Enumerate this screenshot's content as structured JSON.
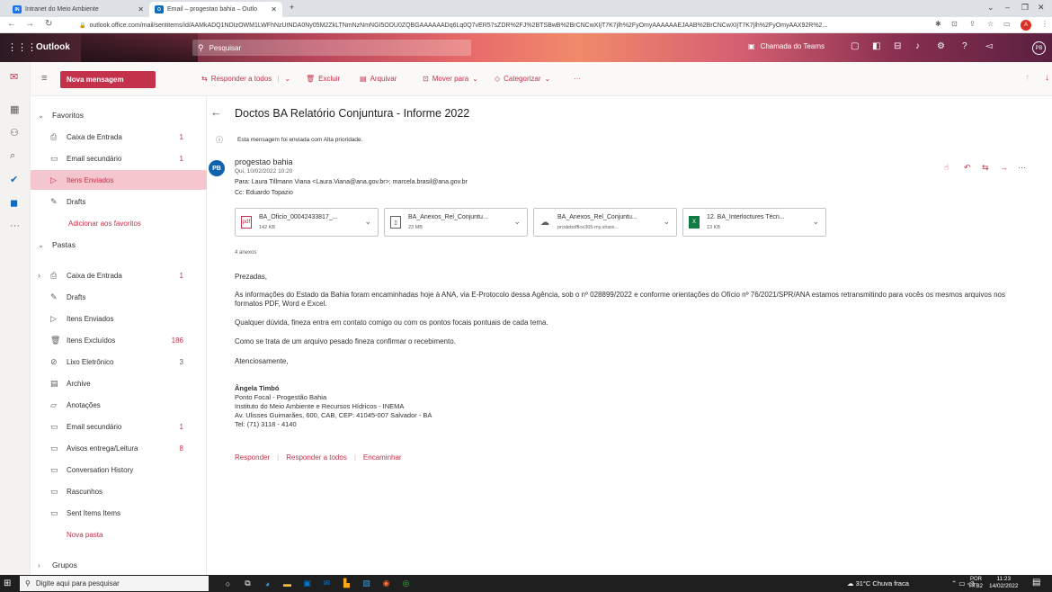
{
  "browser": {
    "tabs": [
      {
        "title": "Intranet do Meio Ambiente",
        "icon": "intranet-icon"
      },
      {
        "title": "Email – progestao bahia – Outlo",
        "icon": "outlook-icon"
      }
    ],
    "url": "outlook.office.com/mail/sentitems/id/AAMkADQ1NDIzOWM1LWFhNzUtNDA0Ny05M2ZkLTNmNzNmNGI5ODU0ZQBGAAAAAADq6Lq0Q7vER57sZDR%2FJ%2BTSBwB%2BrCNCwXIjT7K7jlh%2FyOmyAAAAAAEJAAB%2BrCNCwXIjT7K7jlh%2FyOmyAAX92R%2...",
    "profile_initial": "A"
  },
  "header": {
    "brand": "Outlook",
    "search_placeholder": "Pesquisar",
    "teams_call": "Chamada do Teams",
    "avatar_initials": "PB"
  },
  "commands": {
    "new_message": "Nova mensagem",
    "reply_all": "Responder a todos",
    "delete": "Excluir",
    "archive": "Arquivar",
    "move_to": "Mover para",
    "categorize": "Categorizar",
    "more": "···"
  },
  "folders": {
    "favorites_header": "Favoritos",
    "favorites": [
      {
        "label": "Caixa de Entrada",
        "count": "1",
        "icon": "inbox-icon"
      },
      {
        "label": "Email secundário",
        "count": "1",
        "icon": "folder-icon"
      },
      {
        "label": "Itens Enviados",
        "count": "",
        "icon": "sent-icon"
      },
      {
        "label": "Drafts",
        "count": "",
        "icon": "pencil-icon"
      }
    ],
    "add_favorite": "Adicionar aos favoritos",
    "folders_header": "Pastas",
    "items": [
      {
        "label": "Caixa de Entrada",
        "count": "1",
        "icon": "inbox-icon"
      },
      {
        "label": "Drafts",
        "count": "",
        "icon": "pencil-icon"
      },
      {
        "label": "Itens Enviados",
        "count": "",
        "icon": "sent-icon"
      },
      {
        "label": "Itens Excluídos",
        "count": "186",
        "icon": "trash-icon"
      },
      {
        "label": "Lixo Eletrônico",
        "count": "3",
        "icon": "junk-icon"
      },
      {
        "label": "Archive",
        "count": "",
        "icon": "archive-icon"
      },
      {
        "label": "Anotações",
        "count": "",
        "icon": "notes-icon"
      },
      {
        "label": "Email secundário",
        "count": "1",
        "icon": "folder-icon"
      },
      {
        "label": "Avisos entrega/Leitura",
        "count": "8",
        "icon": "folder-icon"
      },
      {
        "label": "Conversation History",
        "count": "",
        "icon": "folder-icon"
      },
      {
        "label": "Rascunhos",
        "count": "",
        "icon": "folder-icon"
      },
      {
        "label": "Sent Items Items",
        "count": "",
        "icon": "folder-icon"
      }
    ],
    "new_folder": "Nova pasta",
    "groups_header": "Grupos"
  },
  "message": {
    "subject": "Doctos BA Relatório Conjuntura - Informe 2022",
    "priority_notice": "Esta mensagem foi enviada com Alta prioridade.",
    "sender_initials": "PB",
    "sender": "progestao bahia",
    "date": "Qui, 10/02/2022 10:20",
    "to": "Para: Laura Tillmann Viana <Laura.Viana@ana.gov.br>; marcela.brasil@ana.gov.br",
    "cc": "Cc: Eduardo Topazio",
    "attachments": [
      {
        "name": "BA_Oficio_00042433817_...",
        "size": "142 KB",
        "icon": "pdf-icon"
      },
      {
        "name": "BA_Anexos_Rel_Conjuntu...",
        "size": "23 MB",
        "icon": "zip-icon"
      },
      {
        "name": "BA_Anexos_Rel_Conjuntu...",
        "size": "prodeboffice365-my.share...",
        "icon": "cloud-link-icon"
      },
      {
        "name": "12. BA_Interloctures Técn...",
        "size": "13 KB",
        "icon": "excel-icon"
      }
    ],
    "attach_count": "4 anexos",
    "body": [
      "Prezadas,",
      "As informações do Estado da Bahia foram encaminhadas hoje à ANA, via E-Protocolo dessa Agência, sob o nº 028899/2022 e conforme orientações do Ofício nº 76/2021/SPR/ANA estamos retransmitindo para vocês os mesmos arquivos nos formatos PDF, Word e Excel.",
      "Qualquer dúvida, fineza entra em contato comigo ou com os pontos focais pontuais de cada tema.",
      "Como se trata de um arquivo pesado fineza confirmar o recebimento.",
      "Atenciosamente,"
    ],
    "signature": {
      "name": "Ângela Timbó",
      "line1": "Ponto Focal - Progestão Bahia",
      "line2": "Instituto do Meio Ambiente e Recursos Hídricos - INEMA",
      "line3": "Av. Ulisses Guimarães, 600, CAB, CEP: 41045-007 Salvador - BA",
      "line4": "Tel: (71) 3118 - 4140"
    },
    "reply": "Responder",
    "reply_all": "Responder a todos",
    "forward": "Encaminhar"
  },
  "taskbar": {
    "search": "Digite aqui para pesquisar",
    "weather": "31°C  Chuva fraca",
    "lang1": "POR",
    "lang2": "PTB2",
    "time": "11:23",
    "date": "14/02/2022"
  },
  "colors": {
    "accent": "#c4314b",
    "selected": "#f4c6cd",
    "avatar": "#1062ac"
  }
}
